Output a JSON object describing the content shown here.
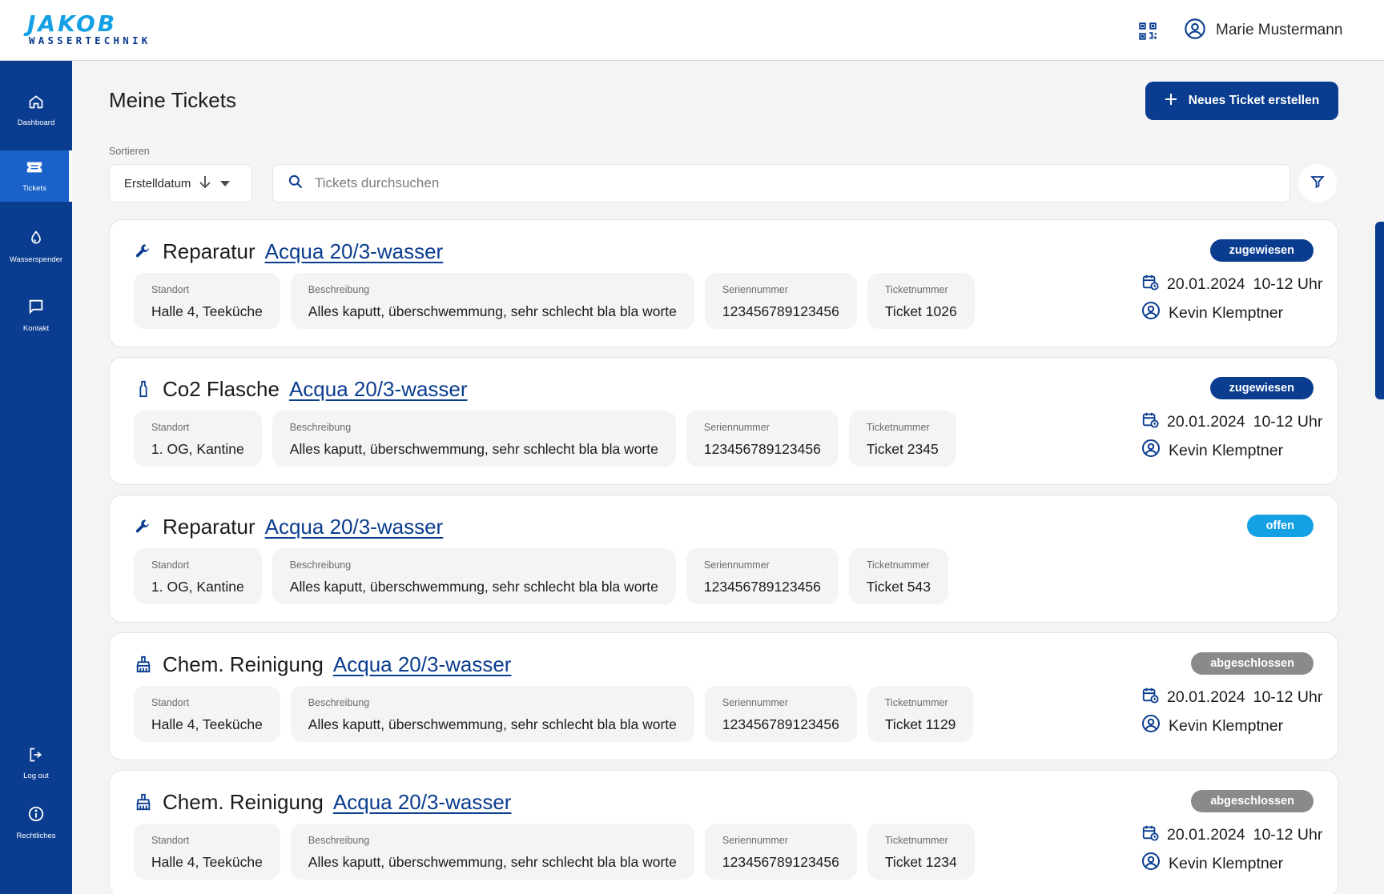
{
  "header": {
    "logo_main": "JAKOB",
    "logo_sub": "WASSERTECHNIK",
    "user_name": "Marie Mustermann"
  },
  "sidebar": {
    "items": [
      {
        "label": "Dashboard",
        "icon": "home-icon"
      },
      {
        "label": "Tickets",
        "icon": "ticket-icon",
        "active": true
      },
      {
        "label": "Wasserspender",
        "icon": "water-drop-icon"
      },
      {
        "label": "Kontakt",
        "icon": "chat-icon"
      }
    ],
    "bottom_items": [
      {
        "label": "Log out",
        "icon": "logout-icon"
      },
      {
        "label": "Rechtliches",
        "icon": "info-icon"
      }
    ]
  },
  "main": {
    "title": "Meine Tickets",
    "new_ticket_label": "Neues Ticket erstellen",
    "sort_label": "Sortieren",
    "sort_value": "Erstelldatum",
    "search_placeholder": "Tickets durchsuchen"
  },
  "field_labels": {
    "location": "Standort",
    "description": "Beschreibung",
    "serial": "Seriennummer",
    "ticket": "Ticketnummer"
  },
  "colors": {
    "primary": "#0a3d8f",
    "accent": "#14a0e4",
    "status_zugewiesen": "#0a3d8f",
    "status_offen": "#14a0e4",
    "status_abgeschlossen": "#8a8a8a"
  },
  "tickets": [
    {
      "category": "Reparatur",
      "category_icon": "wrench-icon",
      "device": "Acqua 20/3-wasser",
      "location": "Halle 4, Teeküche",
      "description": "Alles kaputt, überschwemmung, sehr schlecht bla bla worte",
      "serial": "123456789123456",
      "ticket_no": "Ticket 1026",
      "status": "zugewiesen",
      "date": "20.01.2024",
      "time": "10-12 Uhr",
      "technician": "Kevin Klemptner"
    },
    {
      "category": "Co2 Flasche",
      "category_icon": "bottle-icon",
      "device": "Acqua 20/3-wasser",
      "location": "1. OG, Kantine",
      "description": "Alles kaputt, überschwemmung, sehr schlecht bla bla worte",
      "serial": "123456789123456",
      "ticket_no": "Ticket 2345",
      "status": "zugewiesen",
      "date": "20.01.2024",
      "time": "10-12 Uhr",
      "technician": "Kevin Klemptner"
    },
    {
      "category": "Reparatur",
      "category_icon": "wrench-icon",
      "device": "Acqua 20/3-wasser",
      "location": "1. OG, Kantine",
      "description": "Alles kaputt, überschwemmung, sehr schlecht bla bla worte",
      "serial": "123456789123456",
      "ticket_no": "Ticket 543",
      "status": "offen"
    },
    {
      "category": "Chem. Reinigung",
      "category_icon": "cleaning-brush-icon",
      "device": "Acqua 20/3-wasser",
      "location": "Halle 4, Teeküche",
      "description": "Alles kaputt, überschwemmung, sehr schlecht bla bla worte",
      "serial": "123456789123456",
      "ticket_no": "Ticket 1129",
      "status": "abgeschlossen",
      "date": "20.01.2024",
      "time": "10-12 Uhr",
      "technician": "Kevin Klemptner"
    },
    {
      "category": "Chem. Reinigung",
      "category_icon": "cleaning-brush-icon",
      "device": "Acqua 20/3-wasser",
      "location": "Halle 4, Teeküche",
      "description": "Alles kaputt, überschwemmung, sehr schlecht bla bla worte",
      "serial": "123456789123456",
      "ticket_no": "Ticket 1234",
      "status": "abgeschlossen",
      "date": "20.01.2024",
      "time": "10-12 Uhr",
      "technician": "Kevin Klemptner"
    }
  ]
}
